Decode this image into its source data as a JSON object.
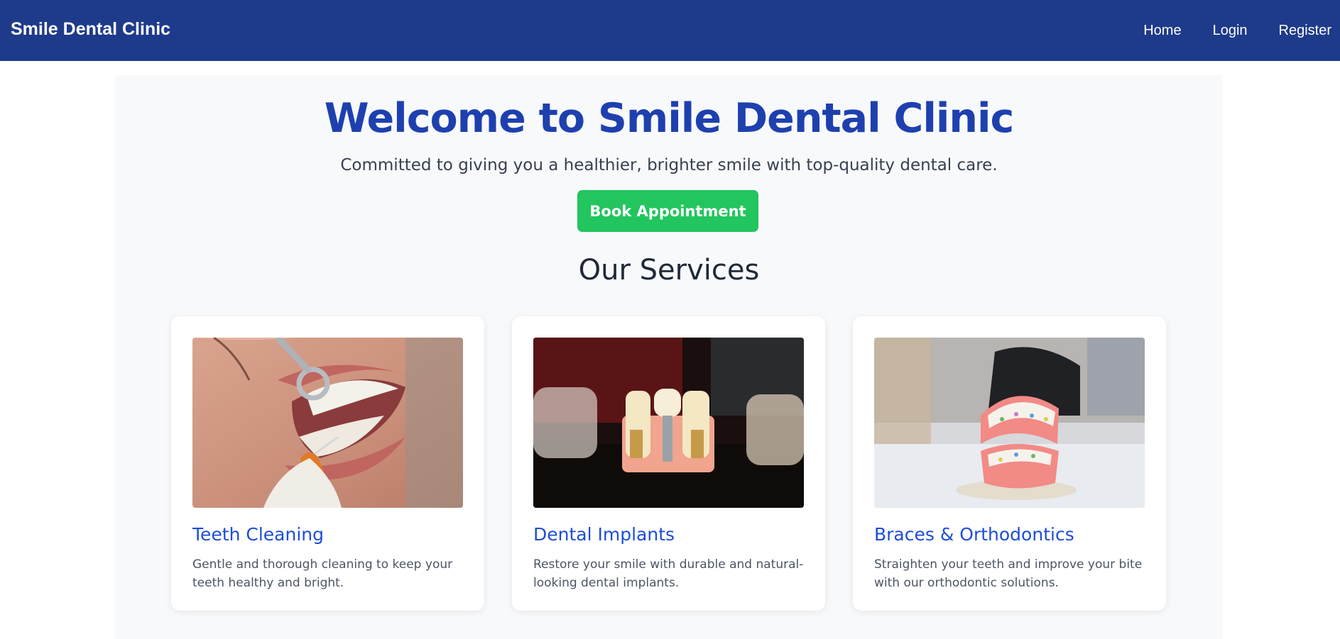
{
  "navbar": {
    "brand": "Smile Dental Clinic",
    "links": [
      "Home",
      "Login",
      "Register"
    ]
  },
  "hero": {
    "title": "Welcome to Smile Dental Clinic",
    "subtitle": "Committed to giving you a healthier, brighter smile with top-quality dental care.",
    "cta_label": "Book Appointment"
  },
  "services": {
    "heading": "Our Services",
    "items": [
      {
        "title": "Teeth Cleaning",
        "description": "Gentle and thorough cleaning to keep your teeth healthy and bright.",
        "image": "teeth-cleaning-photo"
      },
      {
        "title": "Dental Implants",
        "description": "Restore your smile with durable and natural-looking dental implants.",
        "image": "dental-implants-photo"
      },
      {
        "title": "Braces & Orthodontics",
        "description": "Straighten your teeth and improve your bite with our orthodontic solutions.",
        "image": "braces-photo"
      }
    ]
  },
  "colors": {
    "navbar": "#1e3a8a",
    "accent": "#1e40af",
    "cta": "#22c55e",
    "card_title": "#1d4ed8"
  }
}
